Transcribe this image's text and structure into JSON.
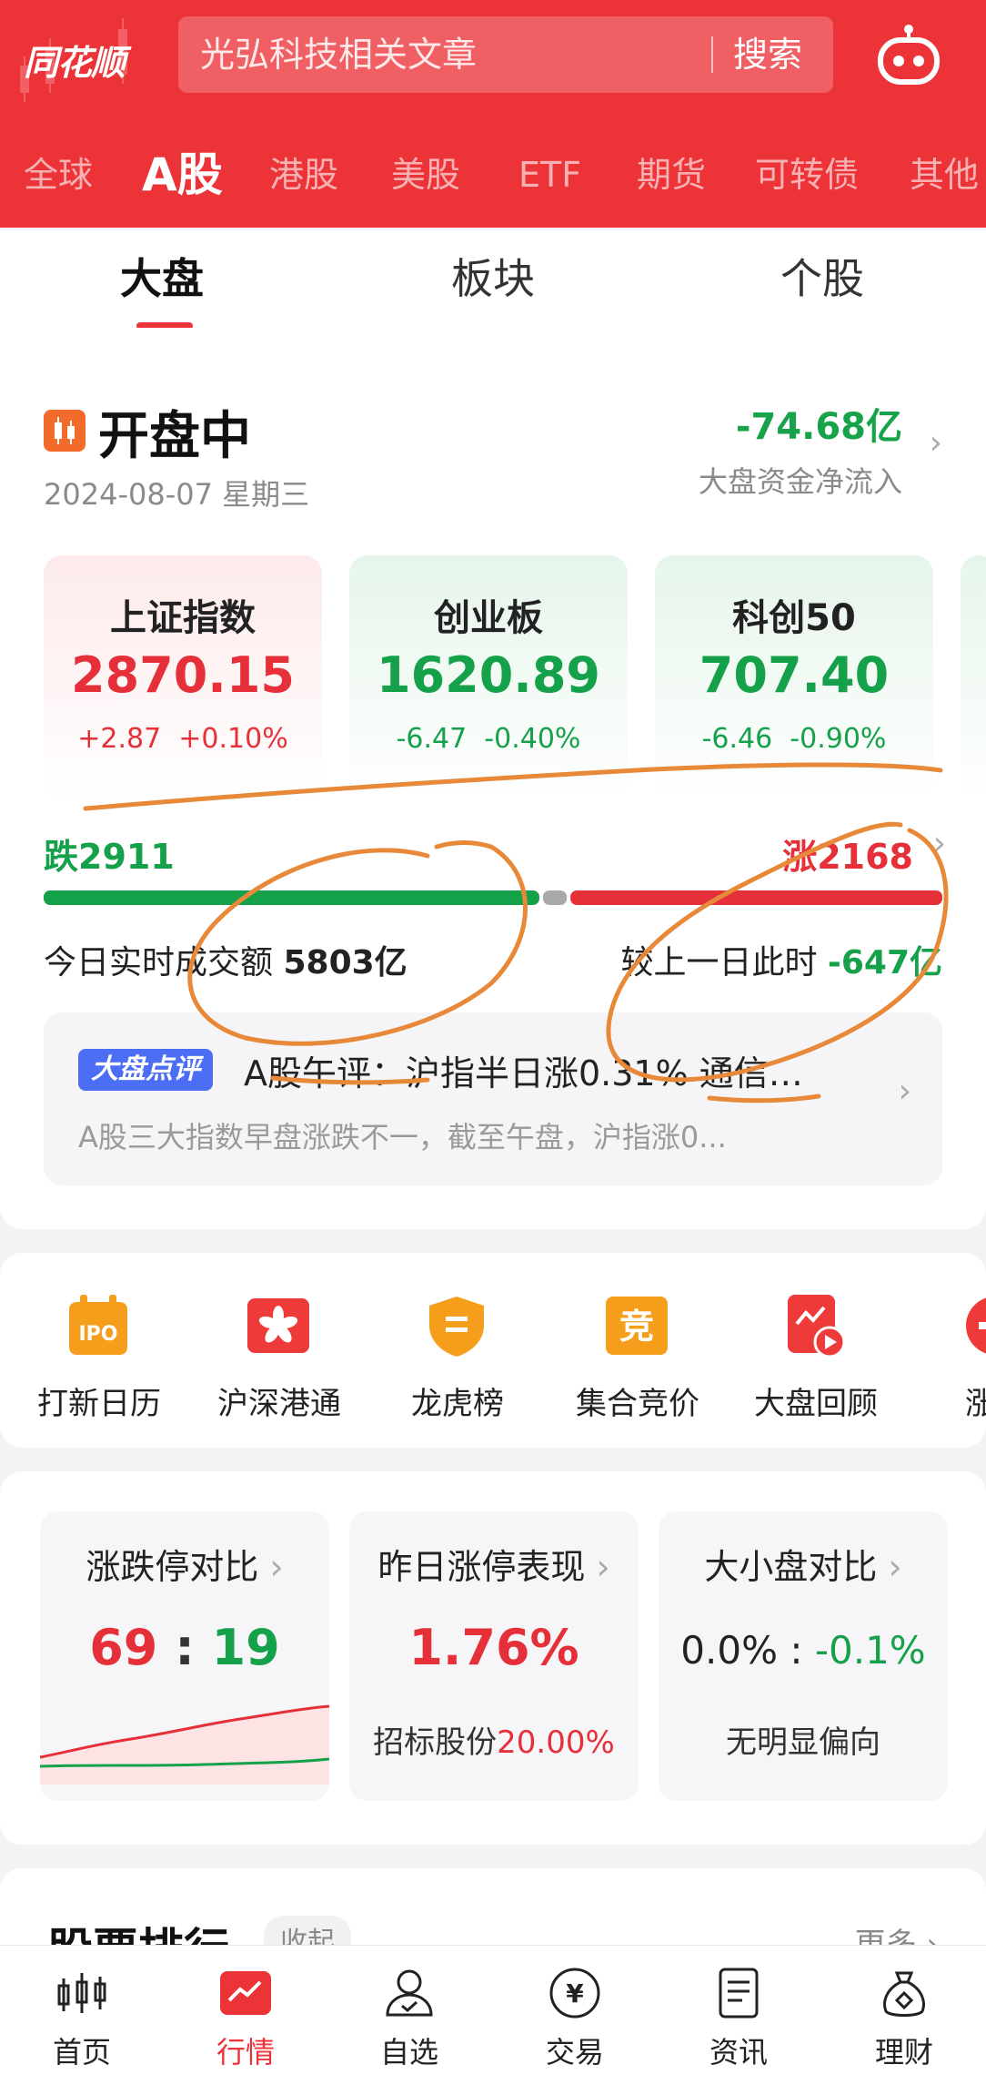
{
  "header": {
    "logo": "同花顺",
    "search_placeholder": "光弘科技相关文章",
    "search_button": "搜索",
    "market_tabs": [
      "全球",
      "A股",
      "港股",
      "美股",
      "ETF",
      "期货",
      "可转债",
      "其他"
    ],
    "active_market_tab": "A股"
  },
  "sub_tabs": [
    "大盘",
    "板块",
    "个股"
  ],
  "overview": {
    "status": "开盘中",
    "date": "2024-08-07 星期三",
    "net_inflow": "-74.68亿",
    "net_inflow_label": "大盘资金净流入",
    "indices": [
      {
        "name": "上证指数",
        "value": "2870.15",
        "change": "+2.87",
        "pct": "+0.10%",
        "trend": "up"
      },
      {
        "name": "创业板",
        "value": "1620.89",
        "change": "-6.47",
        "pct": "-0.40%",
        "trend": "down"
      },
      {
        "name": "科创50",
        "value": "707.40",
        "change": "-6.46",
        "pct": "-0.90%",
        "trend": "down"
      }
    ],
    "fall_count": "跌2911",
    "rise_count": "涨2168",
    "breadth": {
      "fall": 2911,
      "flat": 160,
      "rise": 2168
    },
    "volume_label": "今日实时成交额",
    "volume_value": "5803亿",
    "compare_label": "较上一日此时",
    "compare_value": "-647亿",
    "comment_badge": "大盘点评",
    "comment_title": "A股午评：沪指半日涨0.31% 通信…",
    "comment_sub": "A股三大指数早盘涨跌不一，截至午盘，沪指涨0..."
  },
  "tools": [
    "打新日历",
    "沪深港通",
    "龙虎榜",
    "集合竞价",
    "大盘回顾",
    "涨停"
  ],
  "stats": {
    "limit_compare": {
      "title": "涨跌停对比",
      "up": "69",
      "sep": ":",
      "down": "19"
    },
    "yesterday_limit": {
      "title": "昨日涨停表现",
      "value": "1.76%",
      "sub_label": "招标股份",
      "sub_value": "20.00%"
    },
    "size_compare": {
      "title": "大小盘对比",
      "left": "0.0%",
      "sep": ":",
      "right": "-0.1%",
      "sub": "无明显偏向"
    }
  },
  "ranking": {
    "title": "股票排行",
    "tag": "收起",
    "more": "更多"
  },
  "bottom_nav": [
    "首页",
    "行情",
    "自选",
    "交易",
    "资讯",
    "理财"
  ],
  "active_nav": "行情",
  "colors": {
    "brand_red": "#ec3338",
    "up_red": "#e5303a",
    "down_green": "#15a04a",
    "badge_blue": "#4c6ef5"
  }
}
